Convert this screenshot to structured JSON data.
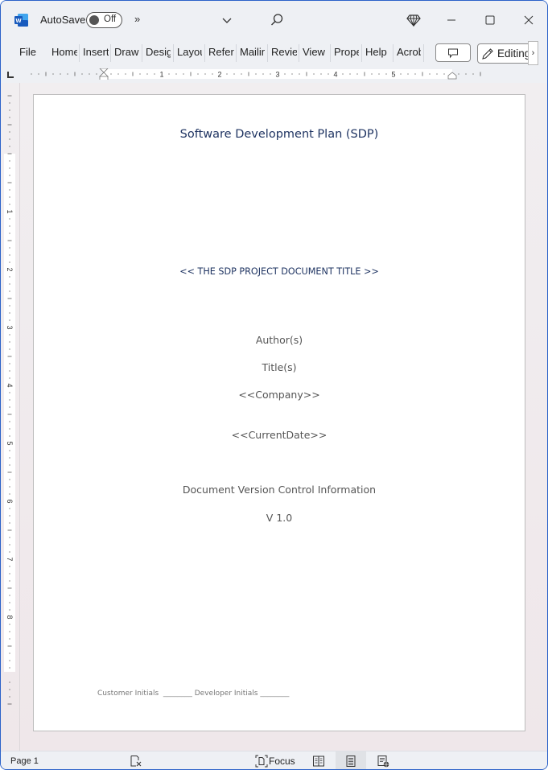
{
  "titlebar": {
    "app_icon": "word-logo-icon",
    "autosave_label": "AutoSave",
    "autosave_state": "Off",
    "more_commands": "»",
    "icons": [
      "chevron-down-icon",
      "search-icon",
      "diamond-icon",
      "minimize-icon",
      "maximize-icon",
      "close-icon"
    ]
  },
  "ribbon": {
    "tabs": [
      {
        "label": "File"
      },
      {
        "label": "Home"
      },
      {
        "label": "Insert"
      },
      {
        "label": "Draw"
      },
      {
        "label": "Design"
      },
      {
        "label": "Layout"
      },
      {
        "label": "References"
      },
      {
        "label": "Mailings"
      },
      {
        "label": "Review"
      },
      {
        "label": "View"
      },
      {
        "label": "Properties"
      },
      {
        "label": "Help"
      },
      {
        "label": "Acrobat"
      }
    ],
    "comment_icon": "comment-icon",
    "editing_label": "Editing",
    "scroll_glyph": "›"
  },
  "ruler": {
    "horizontal_labels": [
      "1",
      "2",
      "3",
      "4",
      "5"
    ],
    "vertical_labels": [
      "1",
      "2",
      "3",
      "4",
      "5",
      "6",
      "7",
      "8"
    ]
  },
  "document": {
    "title": "Software Development Plan (SDP)",
    "subtitle": "<< THE SDP PROJECT DOCUMENT TITLE >>",
    "author": "Author(s)",
    "author_title": "Title(s)",
    "company": "<<Company>>",
    "date": "<<CurrentDate>>",
    "version_heading": "Document Version Control Information",
    "version": "V 1.0",
    "initials_line": "Customer Initials  ________ Developer Initials ________"
  },
  "statusbar": {
    "page": "Page 1",
    "focus_label": "Focus",
    "views": [
      "read-mode",
      "print-layout",
      "web-layout"
    ],
    "active_view": "print-layout"
  },
  "colors": {
    "title_blue": "#1f3462",
    "window_border": "#2b62c9",
    "word_blue": "#185abd"
  }
}
